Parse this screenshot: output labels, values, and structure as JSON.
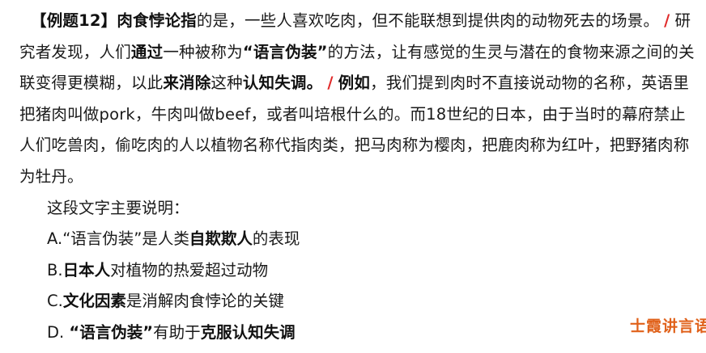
{
  "passage": {
    "label": "【例题12】",
    "term": "肉食悖论指",
    "def_text": "的是，一些人喜欢吃肉，但不能联想到提供肉的动物死去的场景。",
    "slash1": "/",
    "s2a": "研究者发现，人们",
    "s2b": "通过",
    "s2c": "一种被称为",
    "s2d": "“语言伪装”",
    "s2e": "的方法，让有感觉的生灵与潜在的食物来源之间的关联变得更模糊，以此",
    "s2f": "来消除",
    "s2g": "这种",
    "s2h": "认知失调",
    "s2i": "。",
    "slash2": "/",
    "s3a": "例如",
    "s3b": "，我们提到肉时不直接说动物的名称，英语里把猪肉叫做pork，牛肉叫做beef，或者叫培根什么的。而18世纪的日本，由于当时的幕府禁止人们吃兽肉，偷吃肉的人以植物名称代指肉类，把马肉称为樱肉，把鹿肉称为红叶，把野猪肉称为牡丹。"
  },
  "question": "这段文字主要说明：",
  "options": {
    "a": {
      "prefix": "A.“语言伪装”是人类",
      "bold": "自欺欺人",
      "suffix": "的表现"
    },
    "b": {
      "prefix": "B.",
      "bold": "日本人",
      "suffix": "对植物的热爱超过动物"
    },
    "c": {
      "prefix": "C.",
      "bold": "文化因素",
      "suffix": "是消解肉食悖论的关键"
    },
    "d": {
      "prefix": "D. ",
      "bold1": "“语言伪装”",
      "mid": "有助于",
      "bold2": "克服认知失调"
    }
  },
  "brand": "士霞讲言语",
  "colors": {
    "slash": "#e02a2a",
    "brand": "#e0611a"
  }
}
